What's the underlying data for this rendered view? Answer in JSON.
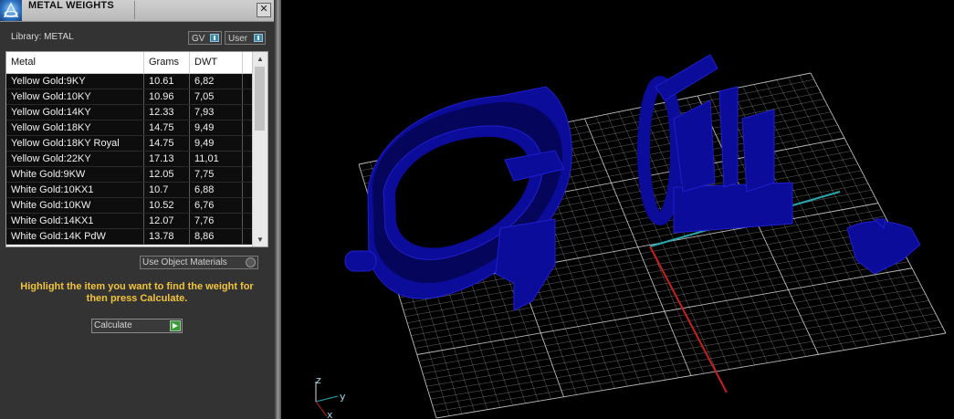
{
  "panel": {
    "title": "METAL WEIGHTS",
    "close_glyph": "✕",
    "library_label": "Library: METAL",
    "toggles": [
      {
        "label": "GV",
        "icon": "toggle-switch-icon"
      },
      {
        "label": "User",
        "icon": "toggle-switch-icon"
      }
    ],
    "table": {
      "headers": [
        "Metal",
        "Grams",
        "DWT"
      ],
      "rows": [
        [
          "Yellow Gold:9KY",
          "10.61",
          "6,82"
        ],
        [
          "Yellow Gold:10KY",
          "10.96",
          "7,05"
        ],
        [
          "Yellow Gold:14KY",
          "12.33",
          "7,93"
        ],
        [
          "Yellow Gold:18KY",
          "14.75",
          "9,49"
        ],
        [
          "Yellow Gold:18KY Royal",
          "14.75",
          "9,49"
        ],
        [
          "Yellow Gold:22KY",
          "17.13",
          "11,01"
        ],
        [
          "White Gold:9KW",
          "12.05",
          "7,75"
        ],
        [
          "White Gold:10KX1",
          "10.7",
          "6,88"
        ],
        [
          "White Gold:10KW",
          "10.52",
          "6,76"
        ],
        [
          "White Gold:14KX1",
          "12.07",
          "7,76"
        ],
        [
          "White Gold:14K PdW",
          "13.78",
          "8,86"
        ]
      ],
      "scroll_up_glyph": "▲",
      "scroll_down_glyph": "▼"
    },
    "use_object_materials": "Use Object Materials",
    "hint_text": "Highlight the item you want to find the weight for then press Calculate.",
    "calculate_label": "Calculate",
    "calculate_glyph": "▶"
  },
  "viewport": {
    "object_color": "#0c0c9a",
    "grid_color": "#cfcfcf",
    "x_axis_color": "#c8201a",
    "y_axis_color": "#2aa7b0",
    "axis_labels": {
      "z": "z",
      "y": "y",
      "x": "x"
    }
  }
}
